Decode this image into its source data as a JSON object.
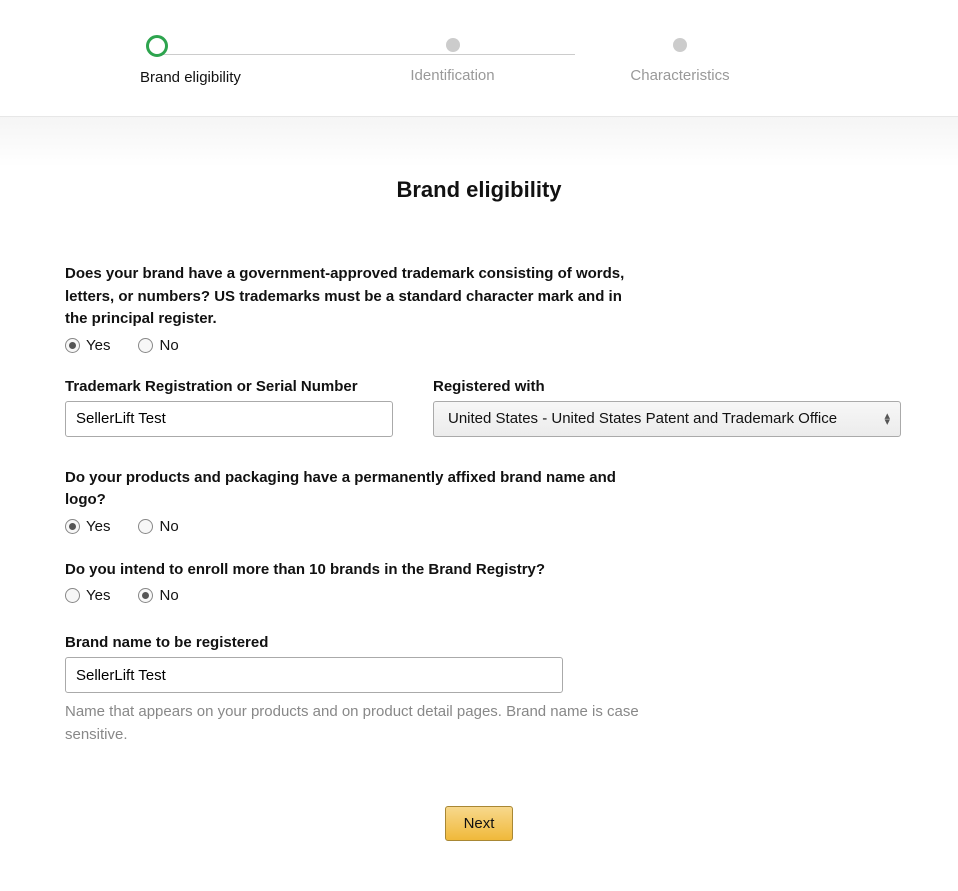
{
  "stepper": {
    "steps": [
      {
        "label": "Brand eligibility",
        "active": true
      },
      {
        "label": "Identification",
        "active": false
      },
      {
        "label": "Characteristics",
        "active": false
      }
    ]
  },
  "page_title": "Brand eligibility",
  "q1": {
    "label": "Does your brand have a government-approved trademark consisting of words, letters, or numbers? US trademarks must be a standard character mark and in the principal register.",
    "yes": "Yes",
    "no": "No",
    "selected": "yes"
  },
  "trademark": {
    "label": "Trademark Registration or Serial Number",
    "value": "SellerLift Test"
  },
  "registered_with": {
    "label": "Registered with",
    "value": "United States - United States Patent and Trademark Office"
  },
  "q2": {
    "label": "Do your products and packaging have a permanently affixed brand name and logo?",
    "yes": "Yes",
    "no": "No",
    "selected": "yes"
  },
  "q3": {
    "label": "Do you intend to enroll more than 10 brands in the Brand Registry?",
    "yes": "Yes",
    "no": "No",
    "selected": "no"
  },
  "brand_name": {
    "label": "Brand name to be registered",
    "value": "SellerLift Test",
    "help": "Name that appears on your products and on product detail pages. Brand name is case sensitive."
  },
  "next_button": "Next"
}
